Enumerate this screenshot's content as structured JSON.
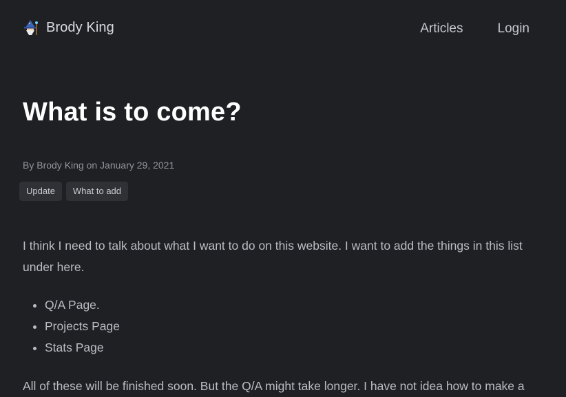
{
  "header": {
    "brand_name": "Brody King",
    "brand_icon": "wizard-avatar-icon",
    "nav": {
      "articles": "Articles",
      "login": "Login"
    }
  },
  "article": {
    "title": "What is to come?",
    "meta": "By Brody King on January 29, 2021",
    "tags": [
      "Update",
      "What to add"
    ],
    "intro": "I think I need to talk about what I want to do on this website. I want to add the things in this list under here.",
    "list": [
      "Q/A Page.",
      "Projects Page",
      "Stats Page"
    ],
    "closing": "All of these will be finished soon. But the Q/A might take longer. I have not idea how to make a"
  },
  "colors": {
    "background": "#1f2023",
    "title": "#ffffff",
    "body_text": "#b9bdc5",
    "tag_bg": "#2f3135"
  }
}
